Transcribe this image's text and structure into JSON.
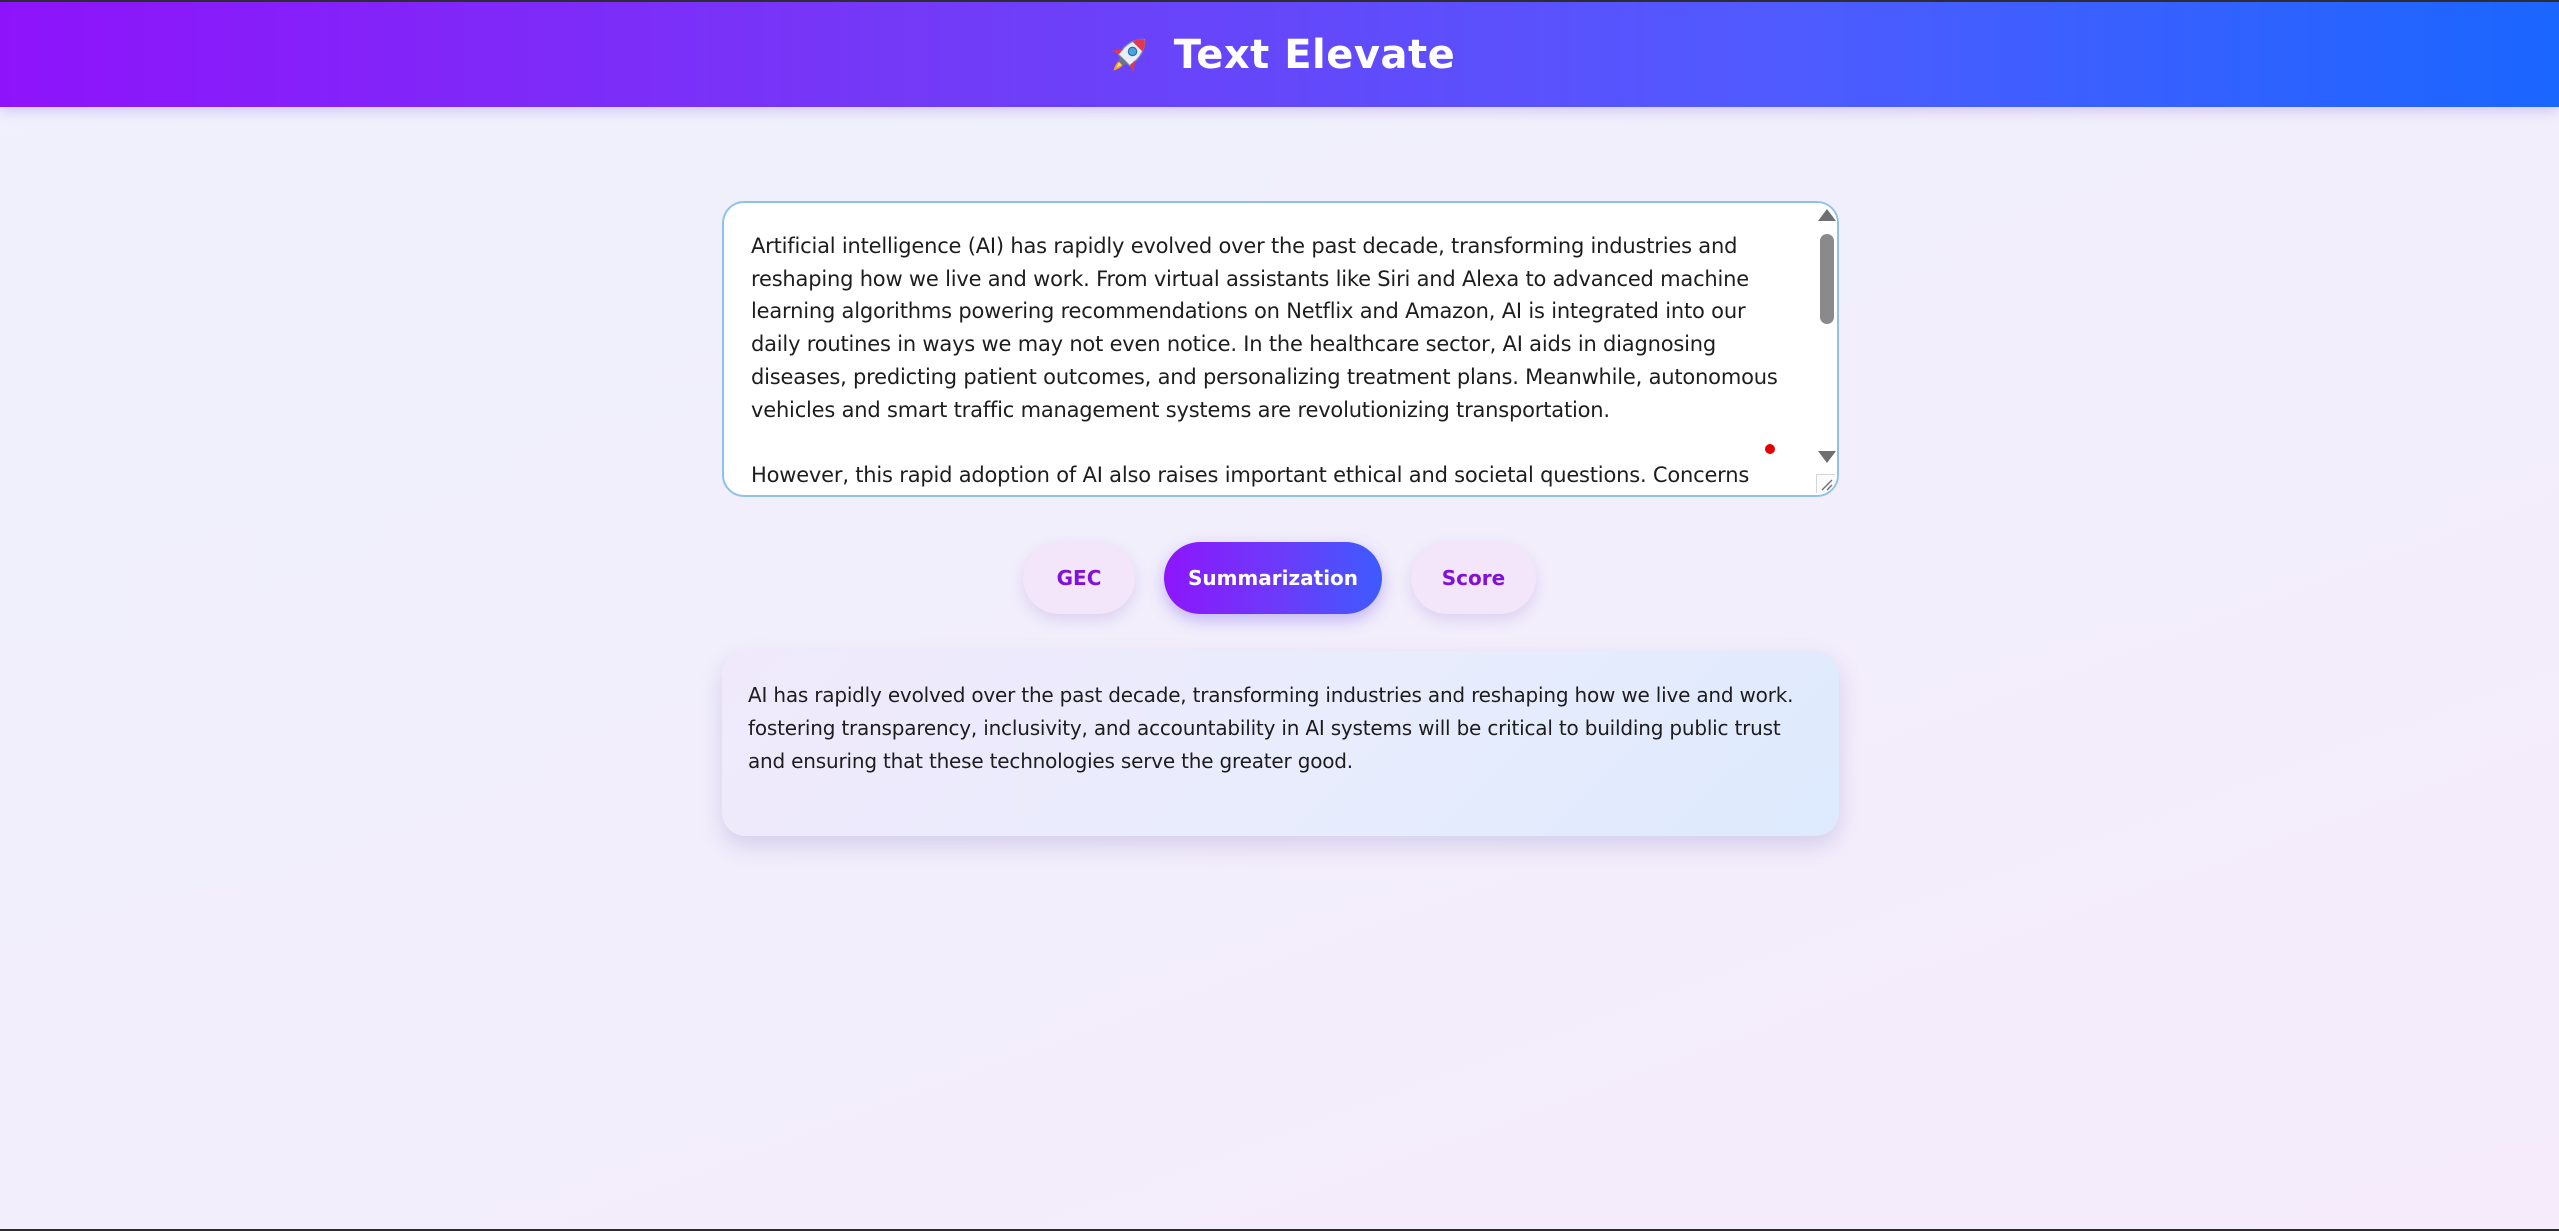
{
  "app": {
    "title": "Text Elevate",
    "logo_icon": "rocket-icon"
  },
  "editor": {
    "value": "Artificial intelligence (AI) has rapidly evolved over the past decade, transforming industries and reshaping how we live and work. From virtual assistants like Siri and Alexa to advanced machine learning algorithms powering recommendations on Netflix and Amazon, AI is integrated into our daily routines in ways we may not even notice. In the healthcare sector, AI aids in diagnosing diseases, predicting patient outcomes, and personalizing treatment plans. Meanwhile, autonomous vehicles and smart traffic management systems are revolutionizing transportation.\n\nHowever, this rapid adoption of AI also raises important ethical and societal questions. Concerns"
  },
  "actions": {
    "gec_label": "GEC",
    "summarization_label": "Summarization",
    "score_label": "Score",
    "active": "Summarization"
  },
  "result": {
    "text": "AI has rapidly evolved over the past decade, transforming industries and reshaping how we live and work. fostering transparency, inclusivity, and accountability in AI systems will be critical to building public trust and ensuring that these technologies serve the greater good."
  },
  "colors": {
    "header_gradient_start": "#8e13fb",
    "header_gradient_end": "#1a66ff",
    "accent_purple": "#8210d6",
    "active_button_start": "#8d16fb",
    "active_button_end": "#3d5bff",
    "editor_border": "#8fc2ea",
    "marker_red": "#e10000"
  }
}
